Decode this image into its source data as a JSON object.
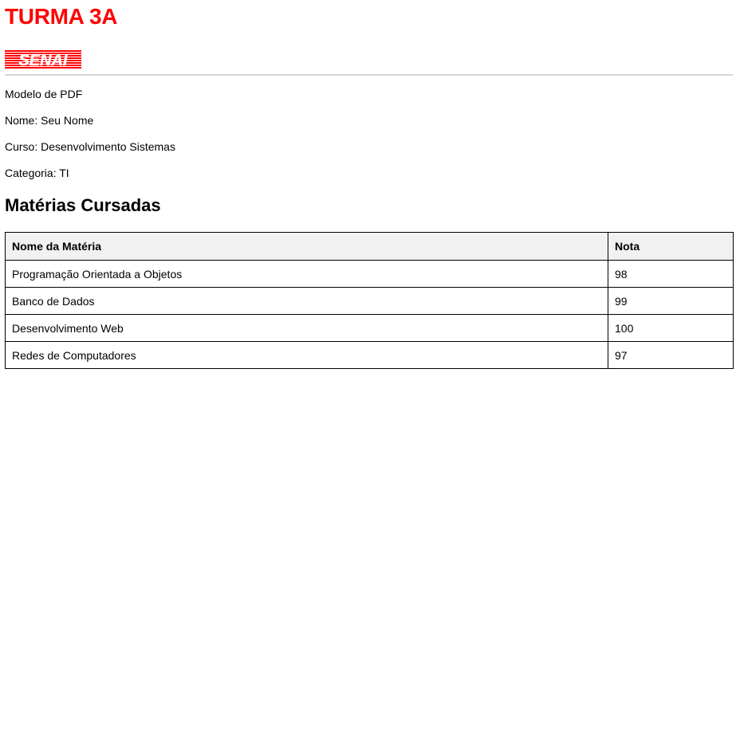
{
  "header": {
    "title": "TURMA 3A",
    "title_color": "#ff0000",
    "logo_text": "SENAI",
    "logo_color": "#ff0000"
  },
  "info": [
    "Modelo de PDF",
    "Nome: Seu Nome",
    "Curso: Desenvolvimento Sistemas",
    "Categoria: TI"
  ],
  "section": {
    "title": "Matérias Cursadas"
  },
  "table": {
    "columns": [
      "Nome da Matéria",
      "Nota"
    ],
    "rows": [
      [
        "Programação Orientada a Objetos",
        "98"
      ],
      [
        "Banco de Dados",
        "99"
      ],
      [
        "Desenvolvimento Web",
        "100"
      ],
      [
        "Redes de Computadores",
        "97"
      ]
    ]
  }
}
